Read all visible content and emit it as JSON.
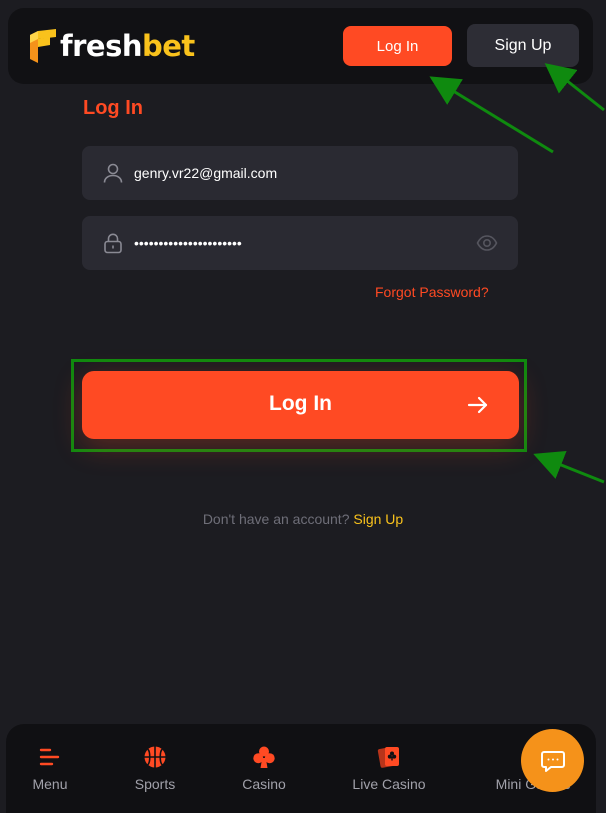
{
  "header": {
    "logo": {
      "fresh": "fresh",
      "bet": "bet"
    },
    "login_label": "Log In",
    "signup_label": "Sign Up"
  },
  "form": {
    "title": "Log In",
    "email": {
      "value": "genry.vr22@gmail.com",
      "icon": "user-icon"
    },
    "password": {
      "value": "••••••••••••••••••••••",
      "icon": "lock-icon",
      "toggle_icon": "eye-icon"
    },
    "forgot_label": "Forgot Password?",
    "submit_label": "Log In",
    "submit_icon": "arrow-right-icon"
  },
  "signup_prompt": {
    "question": "Don't have an account?",
    "link": "Sign Up"
  },
  "bottom_nav": {
    "items": [
      {
        "label": "Menu",
        "icon": "menu-icon"
      },
      {
        "label": "Sports",
        "icon": "basketball-icon"
      },
      {
        "label": "Casino",
        "icon": "club-icon"
      },
      {
        "label": "Live Casino",
        "icon": "cards-icon"
      },
      {
        "label": "Mini Games",
        "icon": "mini-games-icon"
      }
    ]
  },
  "chat": {
    "icon": "chat-icon"
  },
  "colors": {
    "accent": "#ff4a23",
    "brand_yellow": "#f9c21c",
    "background": "#1c1c21",
    "annotation_green": "#0f8a0f",
    "chat": "#f5921a"
  }
}
